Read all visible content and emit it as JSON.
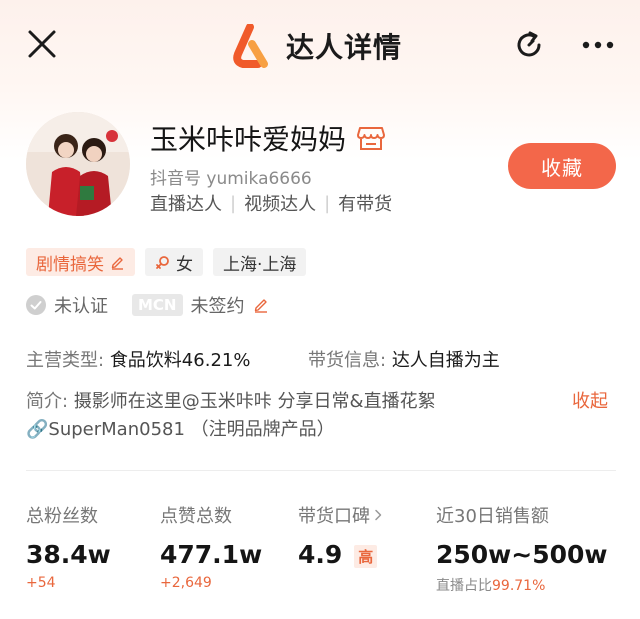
{
  "header": {
    "title": "达人详情"
  },
  "profile": {
    "name": "玉米咔咔爱妈妈",
    "douyin_id": "抖音号 yumika6666",
    "roles": [
      "直播达人",
      "视频达人",
      "有带货"
    ],
    "collect_label": "收藏"
  },
  "tags": [
    {
      "label": "剧情搞笑",
      "icon": "edit-icon"
    },
    {
      "label": "女",
      "icon": "female-icon"
    },
    {
      "label": "上海·上海"
    }
  ],
  "certification": {
    "status": "未认证",
    "mcn_badge": "MCN",
    "mcn_status": "未签约"
  },
  "info": {
    "category_label": "主营类型:",
    "category_value": "食品饮料46.21%",
    "sales_label": "带货信息:",
    "sales_value": "达人自播为主"
  },
  "intro": {
    "label": "简介:",
    "text": "摄影师在这里@玉米咔咔 分享日常&直播花絮 🔗SuperMan0581 （注明品牌产品）",
    "collapse_label": "收起"
  },
  "stats": [
    {
      "label": "总粉丝数",
      "value": "38.4w",
      "sub": "+54"
    },
    {
      "label": "点赞总数",
      "value": "477.1w",
      "sub": "+2,649"
    },
    {
      "label": "带货口碑",
      "value": "4.9",
      "badge": "高"
    },
    {
      "label": "近30日销售额",
      "value": "250w~500w",
      "sub_label": "直播占比",
      "sub_value": "99.71%"
    }
  ],
  "colors": {
    "accent": "#f3674a",
    "accent_text": "#e9673d",
    "tag_bg": "#fdebe4"
  }
}
